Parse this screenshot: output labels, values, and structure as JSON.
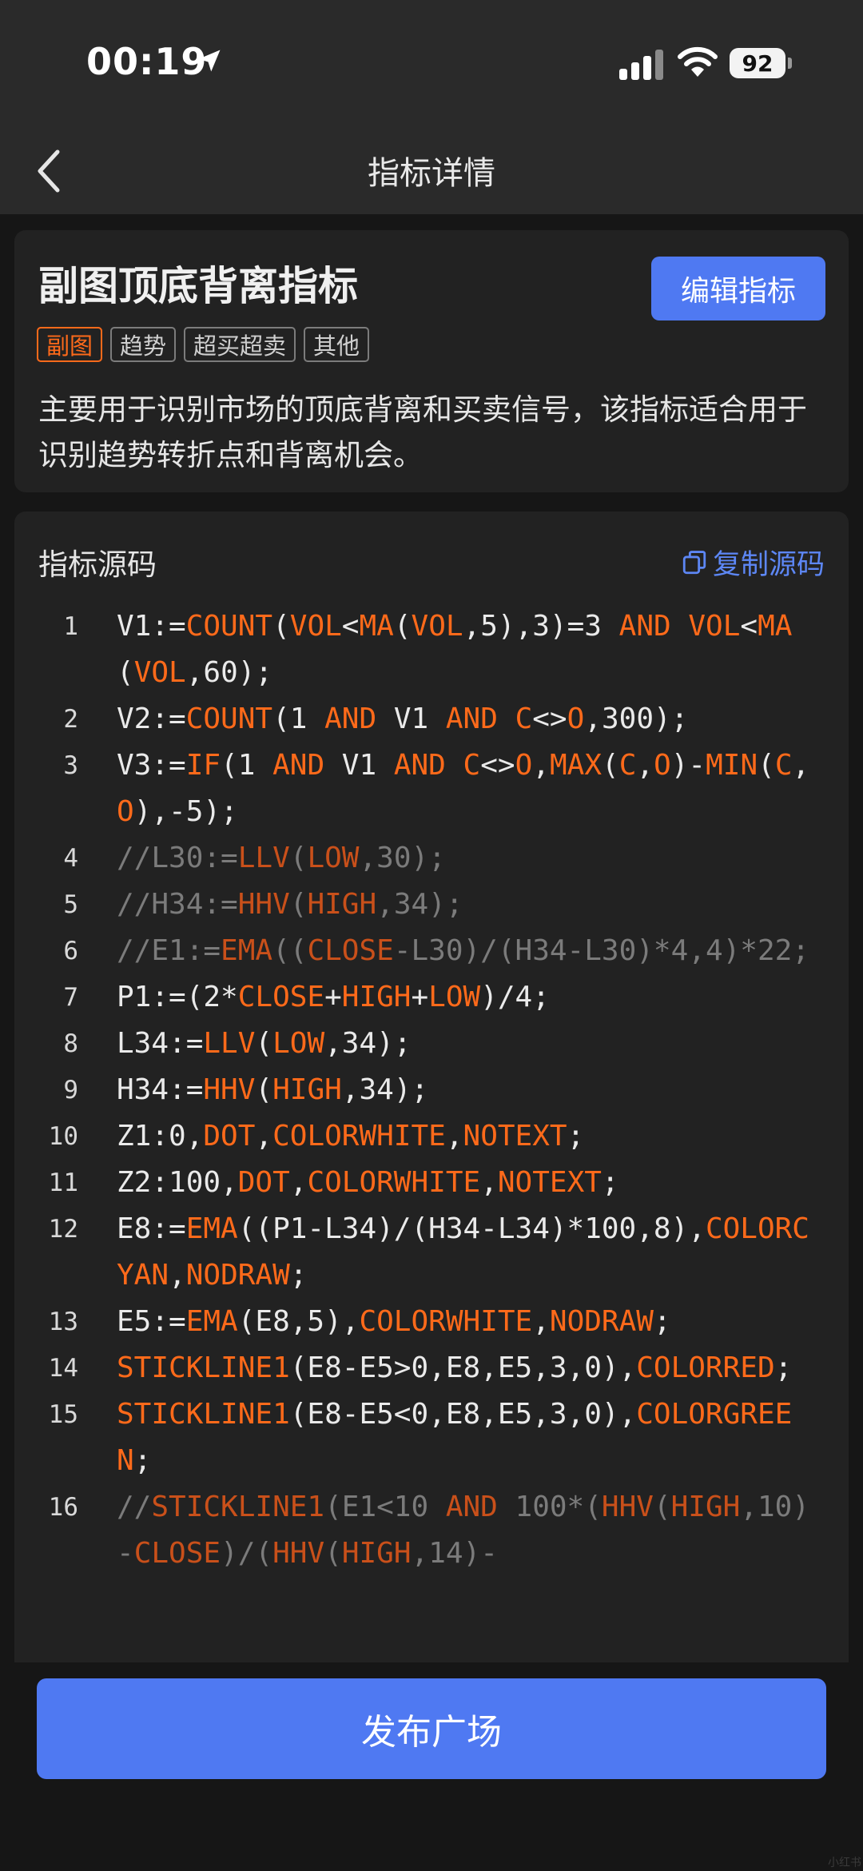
{
  "status_bar": {
    "time": "00:19",
    "battery": "92"
  },
  "nav": {
    "title": "指标详情"
  },
  "indicator": {
    "title": "副图顶底背离指标",
    "edit_label": "编辑指标",
    "tags": [
      {
        "label": "副图",
        "active": true
      },
      {
        "label": "趋势",
        "active": false
      },
      {
        "label": "超买超卖",
        "active": false
      },
      {
        "label": "其他",
        "active": false
      }
    ],
    "description": "主要用于识别市场的顶底背离和买卖信号，该指标适合用于识别趋势转折点和背离机会。"
  },
  "source": {
    "title": "指标源码",
    "copy_label": "复制源码",
    "lines": [
      {
        "n": "1",
        "text": "V1:=COUNT(VOL<MA(VOL,5),3)=3 AND VOL<MA(VOL,60);"
      },
      {
        "n": "2",
        "text": "V2:=COUNT(1 AND V1 AND C<>O,300);"
      },
      {
        "n": "3",
        "text": "V3:=IF(1 AND V1 AND C<>O,MAX(C,O)-MIN(C,O),-5);"
      },
      {
        "n": "4",
        "text": "//L30:=LLV(LOW,30);"
      },
      {
        "n": "5",
        "text": "//H34:=HHV(HIGH,34);"
      },
      {
        "n": "6",
        "text": "//E1:=EMA((CLOSE-L30)/(H34-L30)*4,4)*22;"
      },
      {
        "n": "7",
        "text": "P1:=(2*CLOSE+HIGH+LOW)/4;"
      },
      {
        "n": "8",
        "text": "L34:=LLV(LOW,34);"
      },
      {
        "n": "9",
        "text": "H34:=HHV(HIGH,34);"
      },
      {
        "n": "10",
        "text": "Z1:0,DOT,COLORWHITE,NOTEXT;"
      },
      {
        "n": "11",
        "text": "Z2:100,DOT,COLORWHITE,NOTEXT;"
      },
      {
        "n": "12",
        "text": "E8:=EMA((P1-L34)/(H34-L34)*100,8),COLORCYAN,NODRAW;"
      },
      {
        "n": "13",
        "text": "E5:=EMA(E8,5),COLORWHITE,NODRAW;"
      },
      {
        "n": "14",
        "text": "STICKLINE1(E8-E5>0,E8,E5,3,0),COLORRED;"
      },
      {
        "n": "15",
        "text": "STICKLINE1(E8-E5<0,E8,E5,3,0),COLORGREEN;"
      },
      {
        "n": "16",
        "text": "//STICKLINE1(E1<10 AND 100*(HHV(HIGH,10)-CLOSE)/(HHV(HIGH,14)-"
      }
    ]
  },
  "footer": {
    "publish_label": "发布广场"
  },
  "watermark": "小红书"
}
